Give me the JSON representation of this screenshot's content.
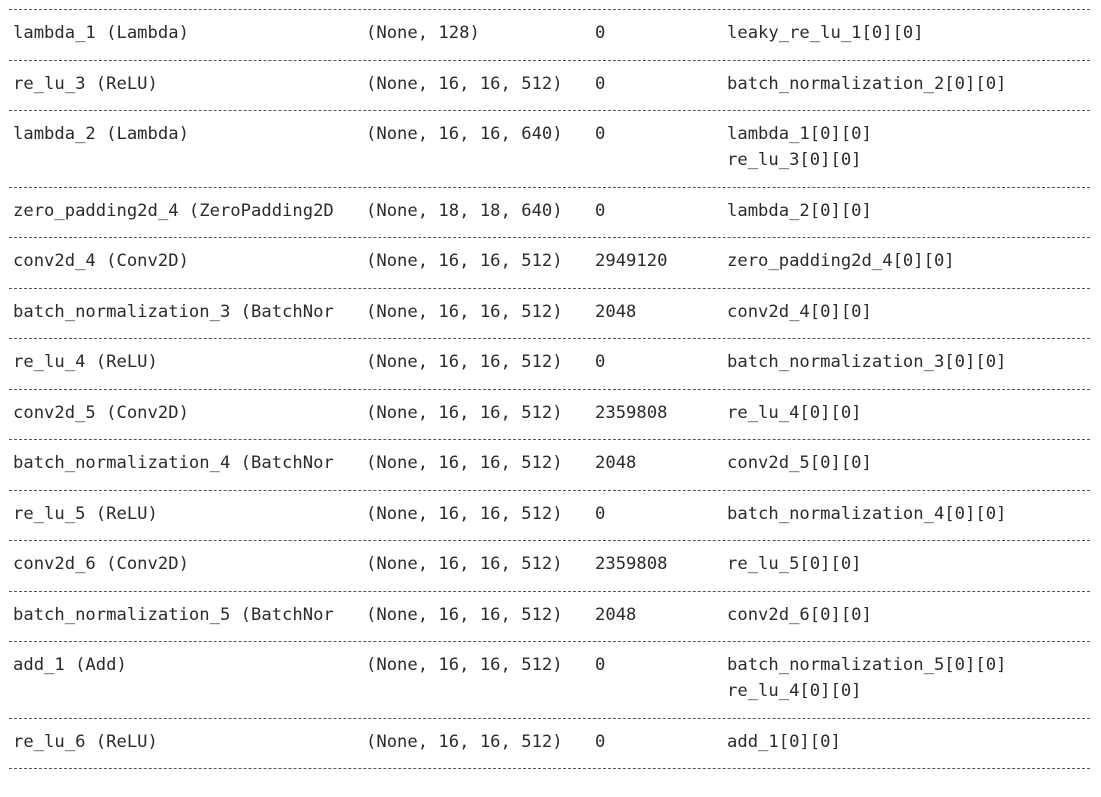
{
  "layers": [
    {
      "name": "lambda_1 (Lambda)",
      "shape": "(None, 128)",
      "params": "0",
      "connected": [
        "leaky_re_lu_1[0][0]"
      ]
    },
    {
      "name": "re_lu_3 (ReLU)",
      "shape": "(None, 16, 16, 512)",
      "params": "0",
      "connected": [
        "batch_normalization_2[0][0]"
      ]
    },
    {
      "name": "lambda_2 (Lambda)",
      "shape": "(None, 16, 16, 640)",
      "params": "0",
      "connected": [
        "lambda_1[0][0]",
        "re_lu_3[0][0]"
      ]
    },
    {
      "name": "zero_padding2d_4 (ZeroPadding2D",
      "shape": "(None, 18, 18, 640)",
      "params": "0",
      "connected": [
        "lambda_2[0][0]"
      ]
    },
    {
      "name": "conv2d_4 (Conv2D)",
      "shape": "(None, 16, 16, 512)",
      "params": "2949120",
      "connected": [
        "zero_padding2d_4[0][0]"
      ]
    },
    {
      "name": "batch_normalization_3 (BatchNor",
      "shape": "(None, 16, 16, 512)",
      "params": "2048",
      "connected": [
        "conv2d_4[0][0]"
      ]
    },
    {
      "name": "re_lu_4 (ReLU)",
      "shape": "(None, 16, 16, 512)",
      "params": "0",
      "connected": [
        "batch_normalization_3[0][0]"
      ]
    },
    {
      "name": "conv2d_5 (Conv2D)",
      "shape": "(None, 16, 16, 512)",
      "params": "2359808",
      "connected": [
        "re_lu_4[0][0]"
      ]
    },
    {
      "name": "batch_normalization_4 (BatchNor",
      "shape": "(None, 16, 16, 512)",
      "params": "2048",
      "connected": [
        "conv2d_5[0][0]"
      ]
    },
    {
      "name": "re_lu_5 (ReLU)",
      "shape": "(None, 16, 16, 512)",
      "params": "0",
      "connected": [
        "batch_normalization_4[0][0]"
      ]
    },
    {
      "name": "conv2d_6 (Conv2D)",
      "shape": "(None, 16, 16, 512)",
      "params": "2359808",
      "connected": [
        "re_lu_5[0][0]"
      ]
    },
    {
      "name": "batch_normalization_5 (BatchNor",
      "shape": "(None, 16, 16, 512)",
      "params": "2048",
      "connected": [
        "conv2d_6[0][0]"
      ]
    },
    {
      "name": "add_1 (Add)",
      "shape": "(None, 16, 16, 512)",
      "params": "0",
      "connected": [
        "batch_normalization_5[0][0]",
        "re_lu_4[0][0]"
      ]
    },
    {
      "name": "re_lu_6 (ReLU)",
      "shape": "(None, 16, 16, 512)",
      "params": "0",
      "connected": [
        "add_1[0][0]"
      ]
    }
  ]
}
